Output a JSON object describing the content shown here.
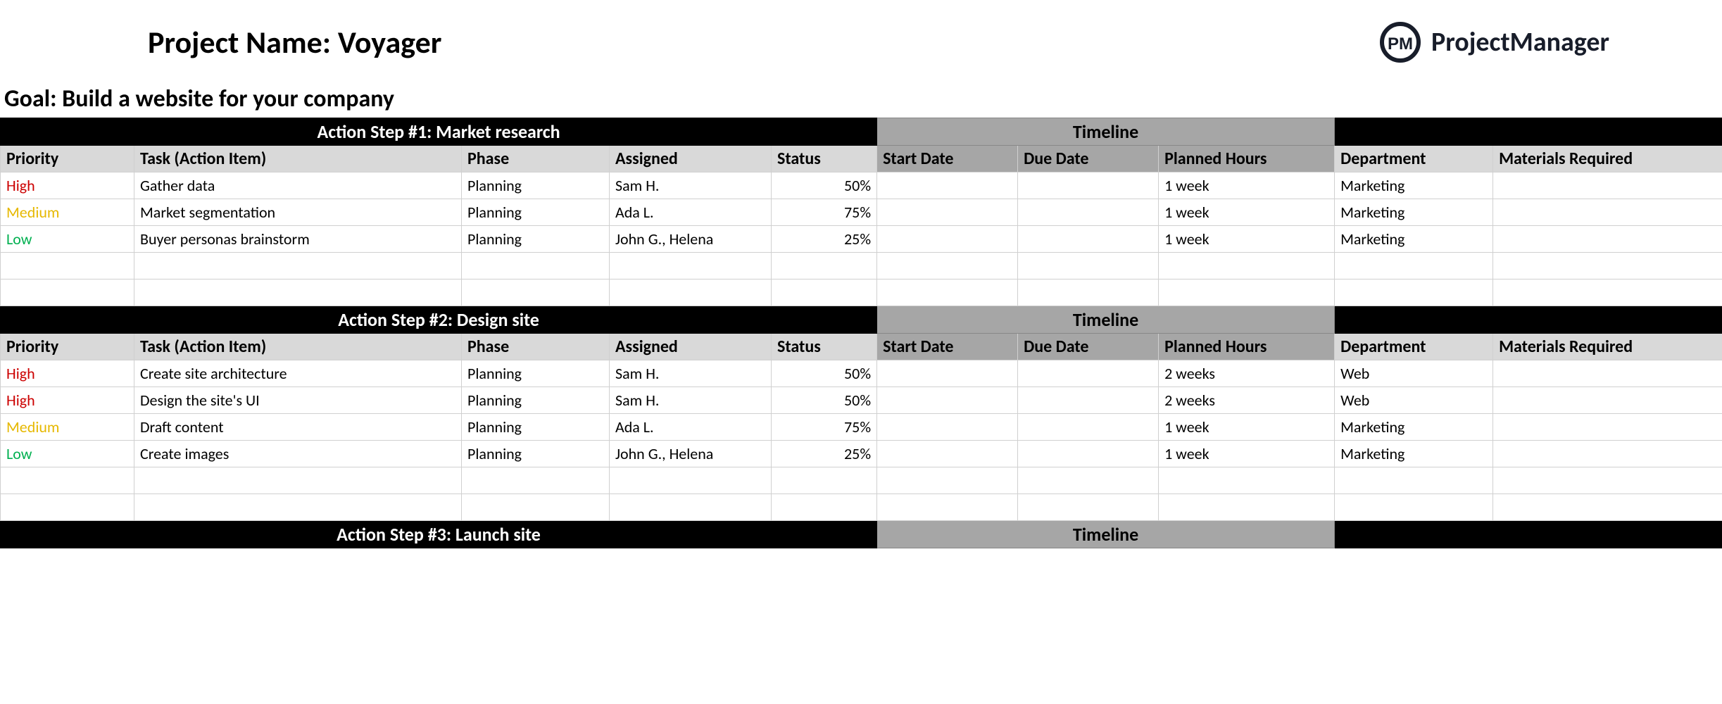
{
  "header": {
    "project_label": "Project Name: Voyager",
    "brand": "ProjectManager"
  },
  "goal": "Goal: Build a website for your company",
  "columns": {
    "priority": "Priority",
    "task": "Task (Action Item)",
    "phase": "Phase",
    "assigned": "Assigned",
    "status": "Status",
    "start": "Start Date",
    "due": "Due Date",
    "hours": "Planned Hours",
    "dept": "Department",
    "materials": "Materials Required"
  },
  "timeline_label": "Timeline",
  "sections": [
    {
      "title": "Action Step #1: Market research",
      "rows": [
        {
          "priority": "High",
          "task": "Gather data",
          "phase": "Planning",
          "assigned": "Sam H.",
          "status": "50%",
          "start": "",
          "due": "",
          "hours": "1 week",
          "dept": "Marketing",
          "materials": ""
        },
        {
          "priority": "Medium",
          "task": "Market segmentation",
          "phase": "Planning",
          "assigned": "Ada L.",
          "status": "75%",
          "start": "",
          "due": "",
          "hours": "1 week",
          "dept": "Marketing",
          "materials": ""
        },
        {
          "priority": "Low",
          "task": "Buyer personas brainstorm",
          "phase": "Planning",
          "assigned": "John G., Helena",
          "status": "25%",
          "start": "",
          "due": "",
          "hours": "1 week",
          "dept": "Marketing",
          "materials": ""
        }
      ],
      "blank_rows": 2
    },
    {
      "title": "Action Step #2: Design site",
      "rows": [
        {
          "priority": "High",
          "task": "Create site architecture",
          "phase": "Planning",
          "assigned": "Sam H.",
          "status": "50%",
          "start": "",
          "due": "",
          "hours": "2 weeks",
          "dept": "Web",
          "materials": ""
        },
        {
          "priority": "High",
          "task": "Design the site's UI",
          "phase": "Planning",
          "assigned": "Sam H.",
          "status": "50%",
          "start": "",
          "due": "",
          "hours": "2 weeks",
          "dept": "Web",
          "materials": ""
        },
        {
          "priority": "Medium",
          "task": "Draft content",
          "phase": "Planning",
          "assigned": "Ada L.",
          "status": "75%",
          "start": "",
          "due": "",
          "hours": "1 week",
          "dept": "Marketing",
          "materials": ""
        },
        {
          "priority": "Low",
          "task": "Create images",
          "phase": "Planning",
          "assigned": "John G., Helena",
          "status": "25%",
          "start": "",
          "due": "",
          "hours": "1 week",
          "dept": "Marketing",
          "materials": ""
        }
      ],
      "blank_rows": 2
    },
    {
      "title": "Action Step #3: Launch site",
      "rows": [],
      "blank_rows": 0,
      "header_only": true
    }
  ]
}
